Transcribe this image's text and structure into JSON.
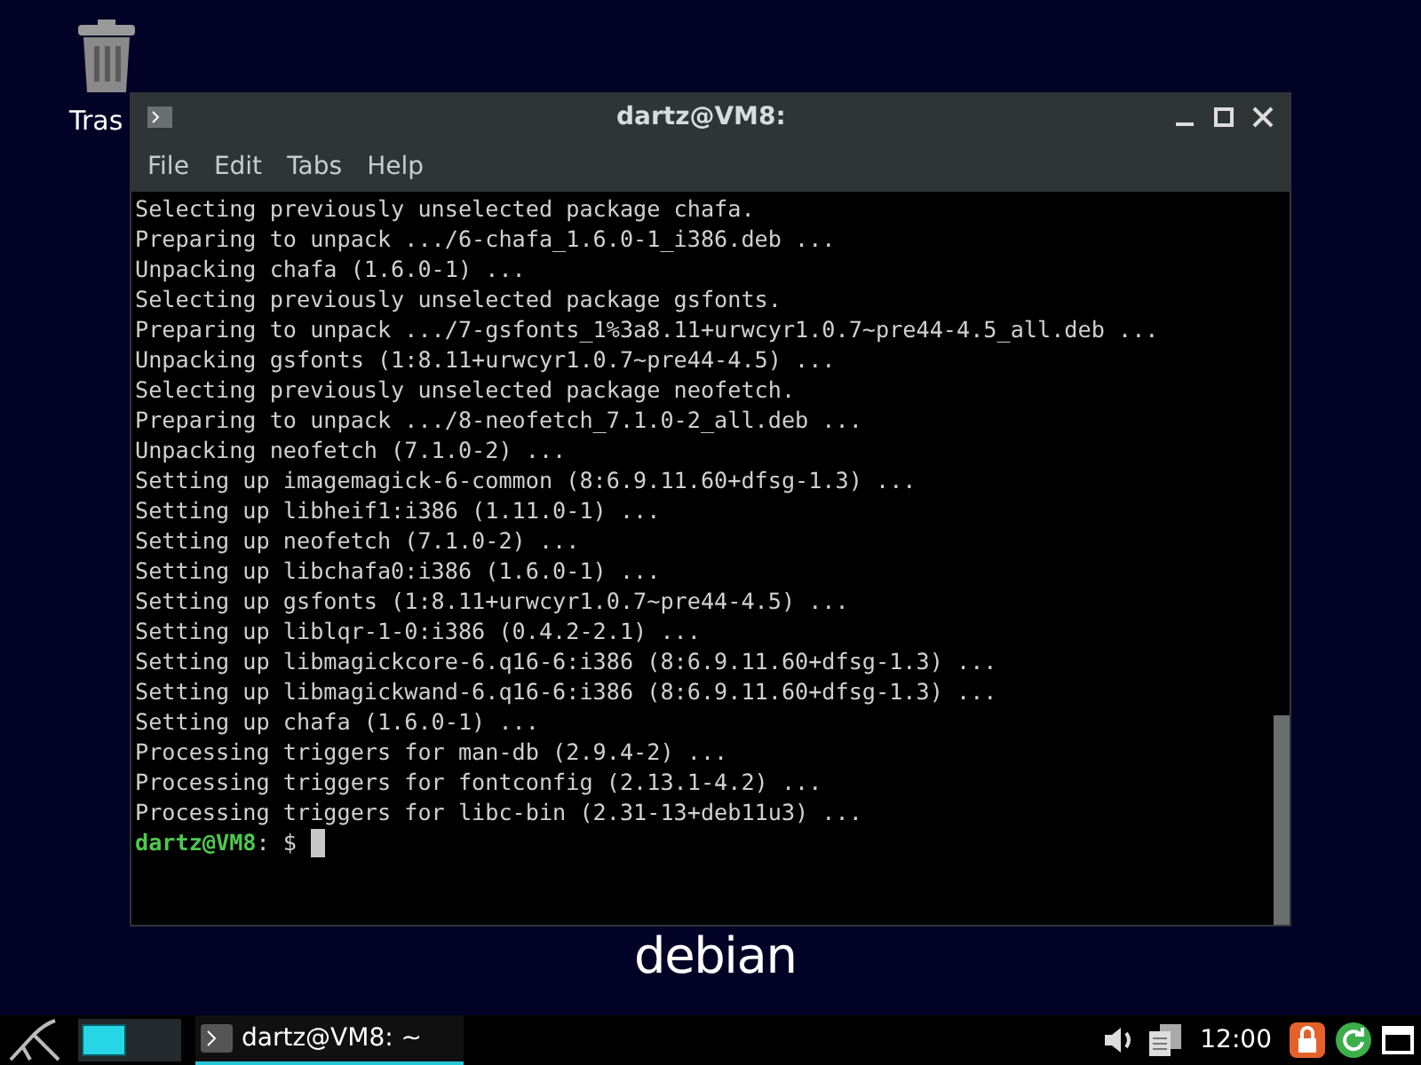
{
  "desktop": {
    "icons": [
      {
        "label": "Tras"
      }
    ],
    "logo": "debian"
  },
  "window": {
    "title": "dartz@VM8:",
    "menu": [
      "File",
      "Edit",
      "Tabs",
      "Help"
    ]
  },
  "terminal": {
    "lines": [
      "Selecting previously unselected package chafa.",
      "Preparing to unpack .../6-chafa_1.6.0-1_i386.deb ...",
      "Unpacking chafa (1.6.0-1) ...",
      "Selecting previously unselected package gsfonts.",
      "Preparing to unpack .../7-gsfonts_1%3a8.11+urwcyr1.0.7~pre44-4.5_all.deb ...",
      "Unpacking gsfonts (1:8.11+urwcyr1.0.7~pre44-4.5) ...",
      "Selecting previously unselected package neofetch.",
      "Preparing to unpack .../8-neofetch_7.1.0-2_all.deb ...",
      "Unpacking neofetch (7.1.0-2) ...",
      "Setting up imagemagick-6-common (8:6.9.11.60+dfsg-1.3) ...",
      "Setting up libheif1:i386 (1.11.0-1) ...",
      "Setting up neofetch (7.1.0-2) ...",
      "Setting up libchafa0:i386 (1.6.0-1) ...",
      "Setting up gsfonts (1:8.11+urwcyr1.0.7~pre44-4.5) ...",
      "Setting up liblqr-1-0:i386 (0.4.2-2.1) ...",
      "Setting up libmagickcore-6.q16-6:i386 (8:6.9.11.60+dfsg-1.3) ...",
      "Setting up libmagickwand-6.q16-6:i386 (8:6.9.11.60+dfsg-1.3) ...",
      "Setting up chafa (1.6.0-1) ...",
      "Processing triggers for man-db (2.9.4-2) ...",
      "Processing triggers for fontconfig (2.13.1-4.2) ...",
      "Processing triggers for libc-bin (2.31-13+deb11u3) ..."
    ],
    "prompt_user": "dartz@VM8",
    "prompt_rest": ": $"
  },
  "taskbar": {
    "workspaces": [
      {
        "selected": true
      },
      {
        "selected": false
      }
    ],
    "tasks": [
      {
        "label": "dartz@VM8: ~",
        "selected": true
      }
    ],
    "clock": "12:00"
  }
}
